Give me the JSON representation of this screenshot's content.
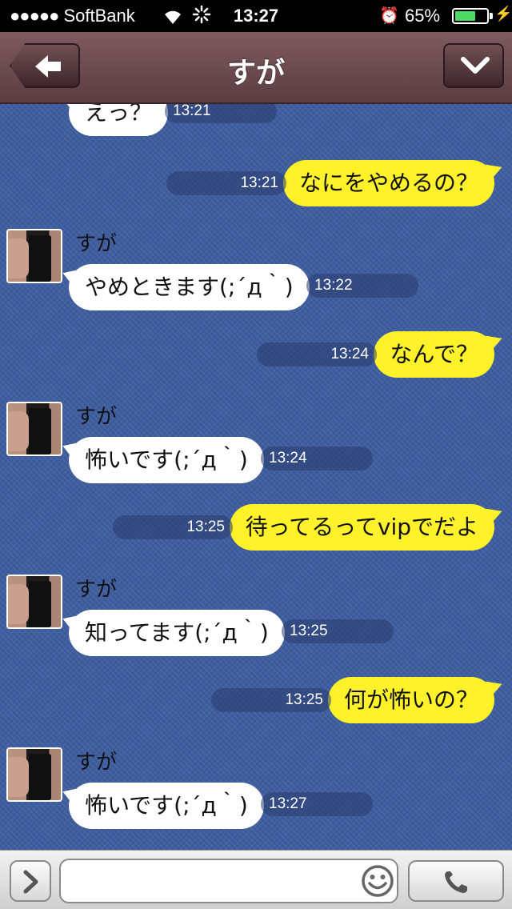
{
  "status_bar": {
    "signal_dots": "●●●●●",
    "carrier": "SoftBank",
    "time": "13:27",
    "battery_percent": "65%",
    "battery_level": 0.65,
    "battery_color": "#4cd964"
  },
  "nav": {
    "title": "すが",
    "back_icon": "back-arrow-icon",
    "menu_icon": "chevron-down-icon",
    "bar_color": "#6b4a4f"
  },
  "chat": {
    "background_color": "#3f5e9f",
    "incoming_bubble_color": "#ffffff",
    "outgoing_bubble_color": "#fff22a",
    "messages": [
      {
        "direction": "in",
        "sender": "",
        "text": "えっ？",
        "time": "13:21"
      },
      {
        "direction": "out",
        "text": "なにをやめるの？",
        "time": "13:21"
      },
      {
        "direction": "in",
        "sender": "すが",
        "text": "やめときます(;´д｀)",
        "time": "13:22"
      },
      {
        "direction": "out",
        "text": "なんで？",
        "time": "13:24"
      },
      {
        "direction": "in",
        "sender": "すが",
        "text": "怖いです(;´д｀)",
        "time": "13:24"
      },
      {
        "direction": "out",
        "text": "待ってるってvipでだよ",
        "time": "13:25"
      },
      {
        "direction": "in",
        "sender": "すが",
        "text": "知ってます(;´д｀)",
        "time": "13:25"
      },
      {
        "direction": "out",
        "text": "何が怖いの？",
        "time": "13:25"
      },
      {
        "direction": "in",
        "sender": "すが",
        "text": "怖いです(;´д｀)",
        "time": "13:27"
      }
    ]
  },
  "input_bar": {
    "message_value": "",
    "expand_icon": "chevron-right-icon",
    "emoji_icon": "smiley-icon",
    "call_icon": "phone-icon"
  }
}
